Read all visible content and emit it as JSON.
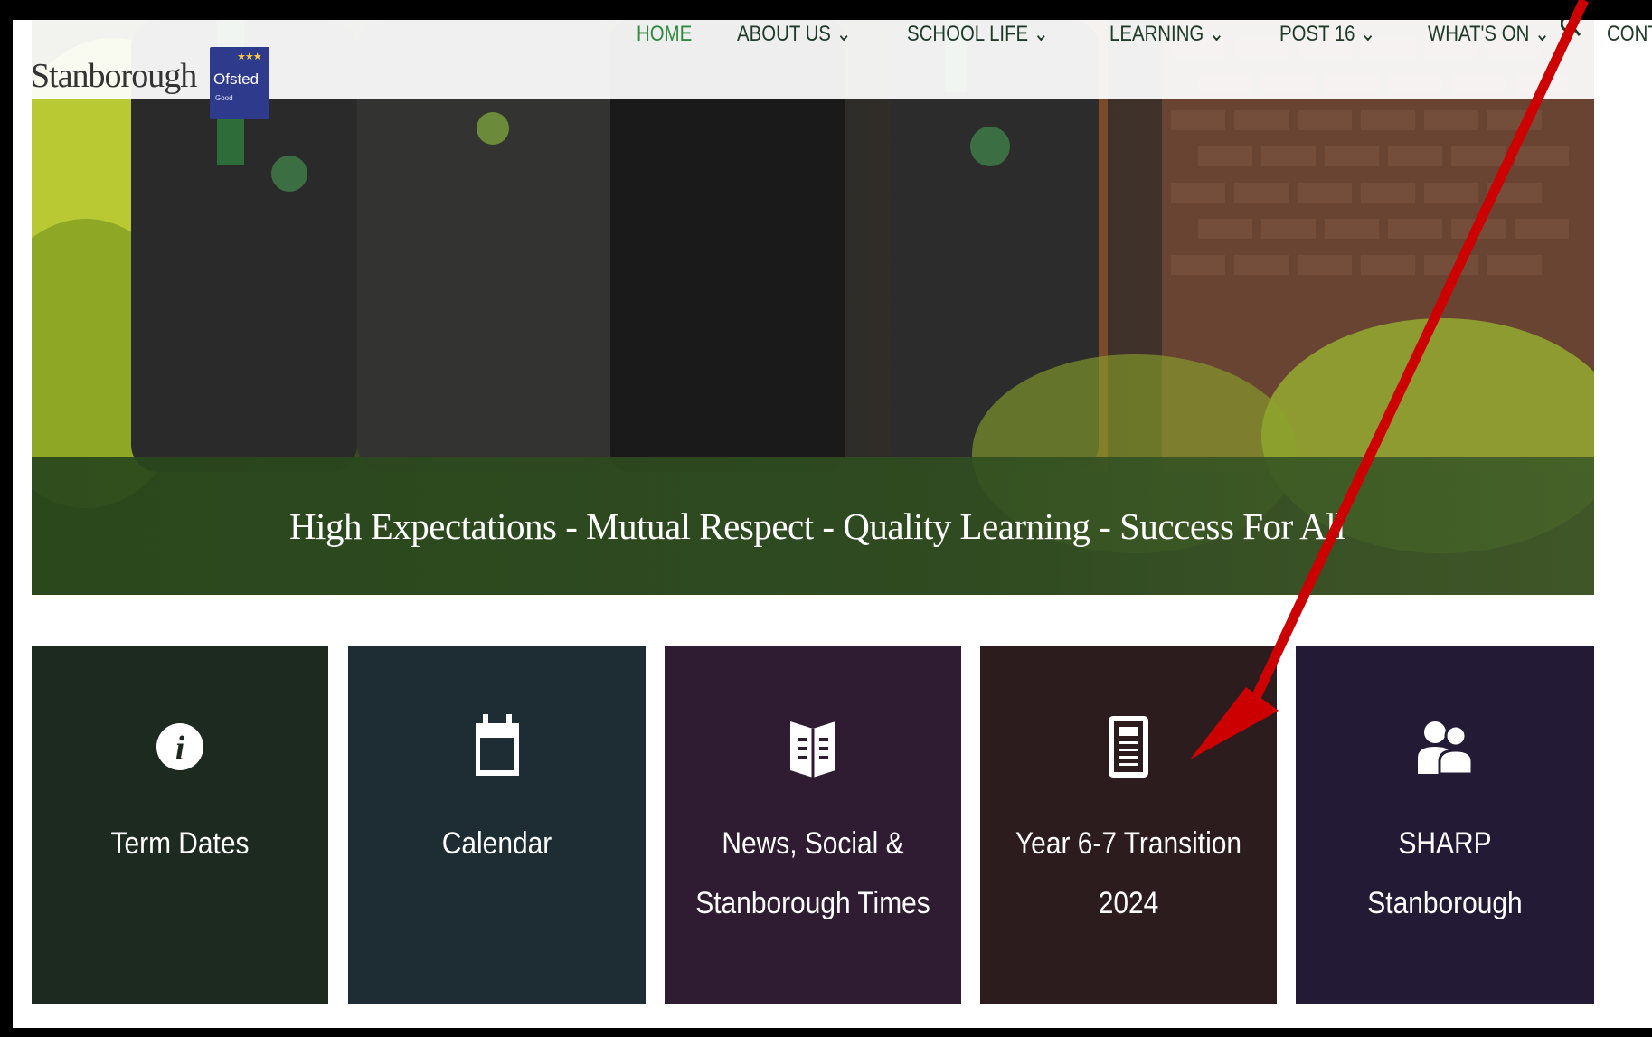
{
  "header": {
    "logo_text": "Stanborough",
    "badge": {
      "text": "Ofsted",
      "subtext": "Good",
      "stars": "★★★"
    },
    "nav": [
      {
        "label": "HOME",
        "active": true
      },
      {
        "label": "ABOUT US ⌄",
        "active": false
      },
      {
        "label": "SCHOOL LIFE ⌄",
        "active": false
      },
      {
        "label": "LEARNING ⌄",
        "active": false
      },
      {
        "label": "POST 16 ⌄",
        "active": false
      },
      {
        "label": "WHAT'S ON ⌄",
        "active": false
      },
      {
        "label": "CONTACT",
        "active": false
      }
    ],
    "search_icon": "search-icon"
  },
  "hero": {
    "tagline": "High Expectations - Mutual Respect - Quality Learning - Success For All"
  },
  "tiles": [
    {
      "icon": "info-icon",
      "line1": "Term Dates",
      "line2": "",
      "color": "#1c2a1f"
    },
    {
      "icon": "calendar-icon",
      "line1": "Calendar",
      "line2": "",
      "color": "#1d2d33"
    },
    {
      "icon": "book-icon",
      "line1": "News, Social &",
      "line2": "Stanborough Times",
      "color": "#2f1c33"
    },
    {
      "icon": "document-icon",
      "line1": "Year 6-7 Transition",
      "line2": "2024",
      "color": "#2d1c1e"
    },
    {
      "icon": "users-icon",
      "line1": "SHARP",
      "line2": "Stanborough",
      "color": "#231b36"
    }
  ],
  "annotation": {
    "color": "#cc0000"
  }
}
